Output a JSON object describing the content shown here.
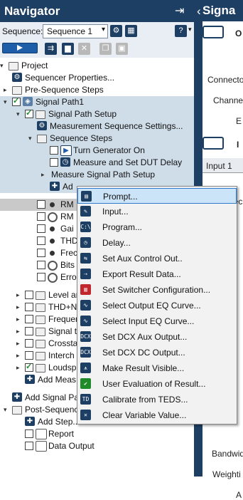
{
  "navigator": {
    "title": "Navigator",
    "sequence_label": "Sequence:",
    "sequence_value": "Sequence 1",
    "help_badge": "?"
  },
  "tree": [
    {
      "label": "Project",
      "depth": 0
    },
    {
      "label": "Sequencer Properties...",
      "depth": 1
    },
    {
      "label": "Pre-Sequence Steps",
      "depth": 1
    },
    {
      "label": "Signal Path1",
      "depth": 1
    },
    {
      "label": "Signal Path Setup",
      "depth": 2
    },
    {
      "label": "Measurement Sequence Settings...",
      "depth": 3
    },
    {
      "label": "Sequence Steps",
      "depth": 3
    },
    {
      "label": "Turn Generator On",
      "depth": 4
    },
    {
      "label": "Measure and Set DUT Delay",
      "depth": 4
    },
    {
      "label": "Measure Signal Path Setup",
      "depth": 4
    },
    {
      "label": "Ad",
      "depth": 4
    },
    {
      "label": "RM",
      "depth": 3
    },
    {
      "label": "RM",
      "depth": 3
    },
    {
      "label": "Gai",
      "depth": 3
    },
    {
      "label": "THD",
      "depth": 3
    },
    {
      "label": "Frec",
      "depth": 3
    },
    {
      "label": "Bits",
      "depth": 3
    },
    {
      "label": "Erro",
      "depth": 3
    },
    {
      "label": "Level an",
      "depth": 2
    },
    {
      "label": "THD+N",
      "depth": 2
    },
    {
      "label": "Frequer",
      "depth": 2
    },
    {
      "label": "Signal t",
      "depth": 2
    },
    {
      "label": "Crossta",
      "depth": 2
    },
    {
      "label": "Interch",
      "depth": 2
    },
    {
      "label": "Loudsp",
      "depth": 2
    },
    {
      "label": "Add Meas",
      "depth": 2
    },
    {
      "label": "Add Signal Pa",
      "depth": 1
    },
    {
      "label": "Post-Sequenc",
      "depth": 1
    },
    {
      "label": "Add Step...",
      "depth": 2
    },
    {
      "label": "Report",
      "depth": 2
    },
    {
      "label": "Data Output",
      "depth": 2
    }
  ],
  "context_menu": [
    {
      "label": "Prompt...",
      "icon": "prompt-icon",
      "glyph": "▤"
    },
    {
      "label": "Input...",
      "icon": "pen-icon",
      "glyph": "✎"
    },
    {
      "label": "Program...",
      "icon": "console-icon",
      "glyph": "C:\\"
    },
    {
      "label": "Delay...",
      "icon": "clock-icon",
      "glyph": "◷"
    },
    {
      "label": "Set Aux Control Out..",
      "icon": "aux-out-icon",
      "glyph": "⇆"
    },
    {
      "label": "Export Result Data...",
      "icon": "export-icon",
      "glyph": "⇢"
    },
    {
      "label": "Set Switcher Configuration...",
      "icon": "switcher-icon",
      "glyph": "▥"
    },
    {
      "label": "Select Output EQ Curve...",
      "icon": "eq-out-icon",
      "glyph": "∿"
    },
    {
      "label": "Select Input EQ Curve...",
      "icon": "eq-in-icon",
      "glyph": "∿"
    },
    {
      "label": "Set DCX Aux Output...",
      "icon": "dcx-aux-icon",
      "glyph": "DCX"
    },
    {
      "label": "Set DCX DC Output...",
      "icon": "dcx-dc-icon",
      "glyph": "DCX"
    },
    {
      "label": "Make Result Visible...",
      "icon": "visible-icon",
      "glyph": "⩚"
    },
    {
      "label": "User Evaluation of Result...",
      "icon": "check-icon",
      "glyph": "✔"
    },
    {
      "label": "Calibrate from TEDS...",
      "icon": "teds-icon",
      "glyph": "TD"
    },
    {
      "label": "Clear Variable Value...",
      "icon": "clear-var-icon",
      "glyph": "✕"
    }
  ],
  "right_panel": {
    "title": "Signa",
    "labels": [
      "O",
      "Connecto",
      "Channel",
      "E",
      "I",
      "Input 1",
      "Connec",
      "Bandwid",
      "Weighti",
      "A"
    ]
  },
  "colors": {
    "header": "#1e3f64",
    "selection": "#cfdde9",
    "menu_active": "#cce4f7"
  }
}
